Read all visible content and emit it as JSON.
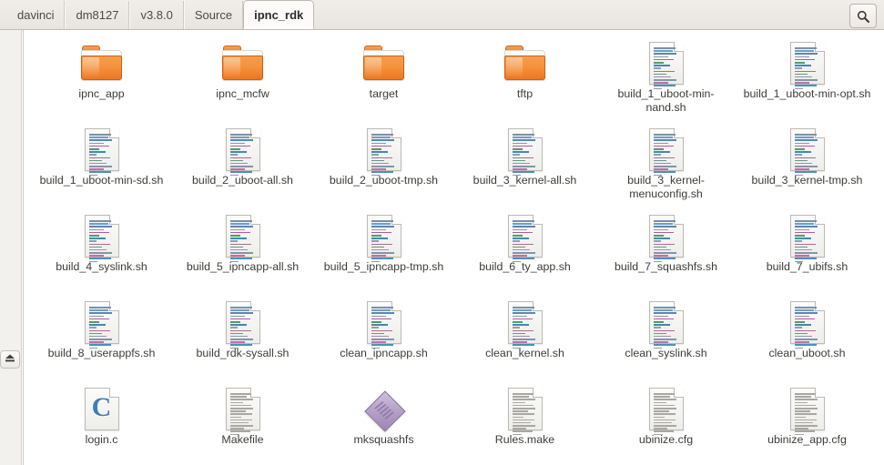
{
  "window": {
    "title": "ipnc_rdk",
    "search_icon": "search-icon",
    "eject_icon": "eject-icon"
  },
  "pathbar": {
    "crumbs": [
      {
        "label": "davinci",
        "active": false
      },
      {
        "label": "dm8127",
        "active": false
      },
      {
        "label": "v3.8.0",
        "active": false
      },
      {
        "label": "Source",
        "active": false
      },
      {
        "label": "ipnc_rdk",
        "active": true
      }
    ]
  },
  "colors": {
    "folder_accent": "#ef7f26",
    "toolbar_bg": "#e8e4df",
    "file_bg": "#ffffff",
    "text": "#3d3c38",
    "csource_accent": "#3f7fb5",
    "executable_accent": "#b29ec6"
  },
  "files": [
    {
      "name": "ipnc_app",
      "kind": "folder",
      "icon": "folder-icon"
    },
    {
      "name": "ipnc_mcfw",
      "kind": "folder",
      "icon": "folder-icon"
    },
    {
      "name": "target",
      "kind": "folder",
      "icon": "folder-icon"
    },
    {
      "name": "tftp",
      "kind": "folder",
      "icon": "folder-icon"
    },
    {
      "name": "build_1_uboot-min-nand.sh",
      "kind": "script",
      "icon": "shell-script-icon"
    },
    {
      "name": "build_1_uboot-min-opt.sh",
      "kind": "script",
      "icon": "shell-script-icon"
    },
    {
      "name": "build_1_uboot-min-sd.sh",
      "kind": "script",
      "icon": "shell-script-icon"
    },
    {
      "name": "build_2_uboot-all.sh",
      "kind": "script",
      "icon": "shell-script-icon"
    },
    {
      "name": "build_2_uboot-tmp.sh",
      "kind": "script",
      "icon": "shell-script-icon"
    },
    {
      "name": "build_3_kernel-all.sh",
      "kind": "script",
      "icon": "shell-script-icon"
    },
    {
      "name": "build_3_kernel-menuconfig.sh",
      "kind": "script",
      "icon": "shell-script-icon"
    },
    {
      "name": "build_3_kernel-tmp.sh",
      "kind": "script",
      "icon": "shell-script-icon"
    },
    {
      "name": "build_4_syslink.sh",
      "kind": "script",
      "icon": "shell-script-icon"
    },
    {
      "name": "build_5_ipncapp-all.sh",
      "kind": "script",
      "icon": "shell-script-icon"
    },
    {
      "name": "build_5_ipncapp-tmp.sh",
      "kind": "script",
      "icon": "shell-script-icon"
    },
    {
      "name": "build_6_ty_app.sh",
      "kind": "script",
      "icon": "shell-script-icon"
    },
    {
      "name": "build_7_squashfs.sh",
      "kind": "script",
      "icon": "shell-script-icon"
    },
    {
      "name": "build_7_ubifs.sh",
      "kind": "script",
      "icon": "shell-script-icon"
    },
    {
      "name": "build_8_userappfs.sh",
      "kind": "script",
      "icon": "shell-script-icon"
    },
    {
      "name": "build_rdk-sysall.sh",
      "kind": "script",
      "icon": "shell-script-icon"
    },
    {
      "name": "clean_ipncapp.sh",
      "kind": "script",
      "icon": "shell-script-icon"
    },
    {
      "name": "clean_kernel.sh",
      "kind": "script",
      "icon": "shell-script-icon"
    },
    {
      "name": "clean_syslink.sh",
      "kind": "script",
      "icon": "shell-script-icon"
    },
    {
      "name": "clean_uboot.sh",
      "kind": "script",
      "icon": "shell-script-icon"
    },
    {
      "name": "login.c",
      "kind": "csource",
      "icon": "c-source-icon"
    },
    {
      "name": "Makefile",
      "kind": "text",
      "icon": "text-file-icon"
    },
    {
      "name": "mksquashfs",
      "kind": "executable",
      "icon": "executable-icon"
    },
    {
      "name": "Rules.make",
      "kind": "text",
      "icon": "text-file-icon"
    },
    {
      "name": "ubinize.cfg",
      "kind": "text",
      "icon": "text-file-icon"
    },
    {
      "name": "ubinize_app.cfg",
      "kind": "text",
      "icon": "text-file-icon"
    }
  ]
}
